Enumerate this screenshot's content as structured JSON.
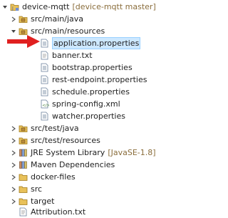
{
  "tree": {
    "project_name": "device-mqtt",
    "project_decoration": "[device-mqtt master]",
    "items": [
      {
        "label": "src/main/java",
        "decoration": "",
        "icon": "package-folder-icon",
        "expanded": false
      },
      {
        "label": "src/main/resources",
        "decoration": "",
        "icon": "package-folder-icon",
        "expanded": true
      },
      {
        "label": "application.properties",
        "decoration": "",
        "icon": "properties-file-icon",
        "selected": true
      },
      {
        "label": "banner.txt",
        "decoration": "",
        "icon": "text-file-icon"
      },
      {
        "label": "bootstrap.properties",
        "decoration": "",
        "icon": "properties-file-icon"
      },
      {
        "label": "rest-endpoint.properties",
        "decoration": "",
        "icon": "properties-file-icon"
      },
      {
        "label": "schedule.properties",
        "decoration": "",
        "icon": "properties-file-icon"
      },
      {
        "label": "spring-config.xml",
        "decoration": "",
        "icon": "xml-file-icon"
      },
      {
        "label": "watcher.properties",
        "decoration": "",
        "icon": "properties-file-icon"
      },
      {
        "label": "src/test/java",
        "decoration": "",
        "icon": "package-folder-icon",
        "expanded": false
      },
      {
        "label": "src/test/resources",
        "decoration": "",
        "icon": "package-folder-icon",
        "expanded": false
      },
      {
        "label": "JRE System Library",
        "decoration": "[JavaSE-1.8]",
        "icon": "library-icon",
        "expanded": false
      },
      {
        "label": "Maven Dependencies",
        "decoration": "",
        "icon": "library-icon",
        "expanded": false
      },
      {
        "label": "docker-files",
        "decoration": "",
        "icon": "folder-icon",
        "expanded": false
      },
      {
        "label": "src",
        "decoration": "",
        "icon": "folder-icon",
        "expanded": false
      },
      {
        "label": "target",
        "decoration": "",
        "icon": "folder-icon",
        "expanded": false
      },
      {
        "label": "Attribution.txt",
        "decoration": "",
        "icon": "text-file-icon"
      }
    ]
  },
  "colors": {
    "selection": "#cde8ff",
    "arrow": "#e02020",
    "decoration": "#8a6d3b"
  }
}
